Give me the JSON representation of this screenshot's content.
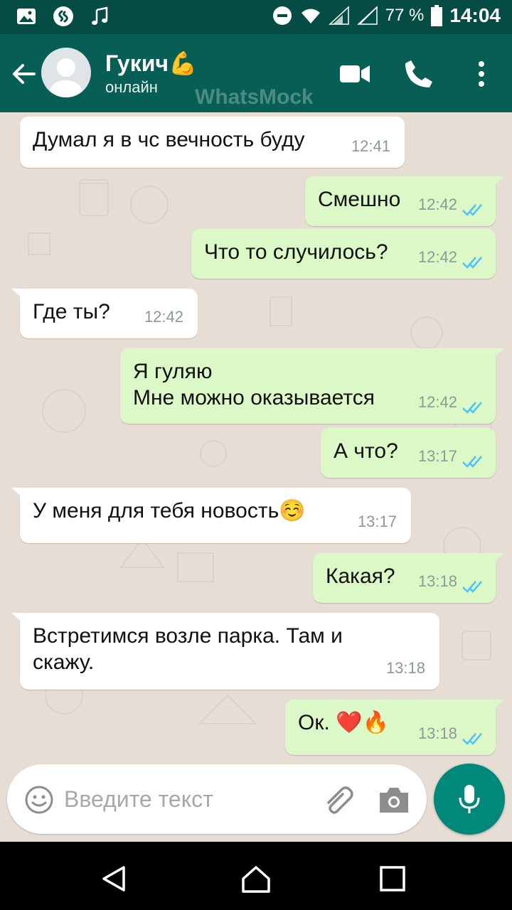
{
  "status_bar": {
    "left_icons": [
      "gallery-icon",
      "shazam-icon",
      "music-icon"
    ],
    "battery_percent": "77 %",
    "time": "14:04"
  },
  "header": {
    "contact_name": "Гукич💪",
    "contact_status": "онлайн",
    "watermark": "WhatsMock"
  },
  "colors": {
    "header": "#075e54",
    "status_bar": "#054d44",
    "outgoing_bubble": "#dcf8c6",
    "incoming_bubble": "#ffffff",
    "read_ticks": "#4fc3f7",
    "mic_button": "#00897b",
    "chat_background": "#e6ded5"
  },
  "messages": [
    {
      "direction": "in",
      "text": "Думал я в чс вечность буду",
      "time": "12:41"
    },
    {
      "direction": "out",
      "text": "Смешно",
      "time": "12:42",
      "status": "read"
    },
    {
      "direction": "out",
      "text": "Что то случилось?",
      "time": "12:42",
      "status": "read"
    },
    {
      "direction": "in",
      "text": "Где ты?",
      "time": "12:42"
    },
    {
      "direction": "out",
      "lines": [
        "Я гуляю",
        "Мне можно оказывается"
      ],
      "time": "12:42",
      "status": "read"
    },
    {
      "direction": "out",
      "text": "А что?",
      "time": "13:17",
      "status": "read"
    },
    {
      "direction": "in",
      "text": "У меня для тебя новость☺️",
      "time": "13:17"
    },
    {
      "direction": "out",
      "text": "Какая?",
      "time": "13:18",
      "status": "read"
    },
    {
      "direction": "in",
      "lines": [
        "Встретимся возле парка. Там и",
        "скажу."
      ],
      "time": "13:18"
    },
    {
      "direction": "out",
      "text": "Ок. ❤️🔥",
      "time": "13:18",
      "status": "read"
    }
  ],
  "composer": {
    "placeholder": "Введите текст",
    "value": ""
  }
}
